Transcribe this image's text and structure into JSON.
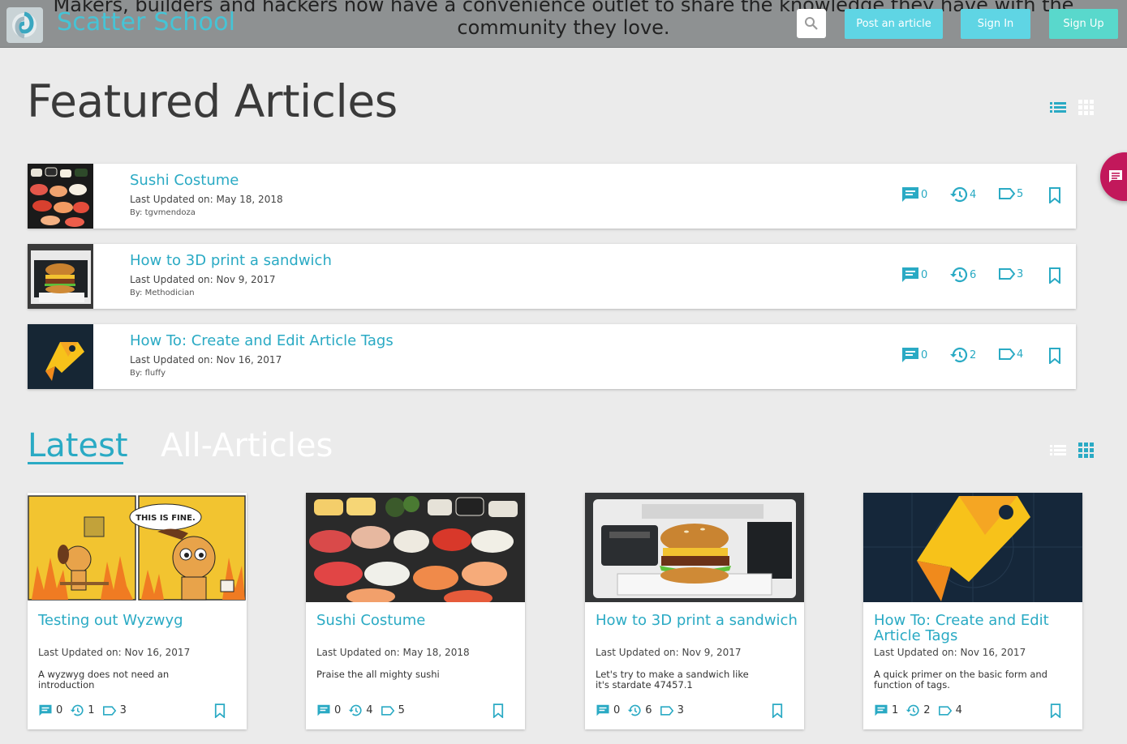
{
  "header": {
    "brand": "Scatter School",
    "tagline": "Makers, builders and hackers now have a convenience outlet to share the knowledge they have with the community they love.",
    "buttons": {
      "post": "Post an article",
      "signin": "Sign In",
      "signup": "Sign Up"
    },
    "colors": {
      "bar": "#8e9192",
      "accent": "#5fd5e4",
      "signup": "#59d8cc"
    }
  },
  "featured": {
    "title": "Featured Articles",
    "items": [
      {
        "title": "Sushi Costume",
        "updated_label": "Last Updated on:",
        "updated": "May 18, 2018",
        "by_label": "By:",
        "author": "tgvmendoza",
        "comments": "0",
        "revisions": "4",
        "tags": "5",
        "thumb": "sushi"
      },
      {
        "title": "How to 3D print a sandwich",
        "updated_label": "Last Updated on:",
        "updated": "Nov 9, 2017",
        "by_label": "By:",
        "author": "Methodician",
        "comments": "0",
        "revisions": "6",
        "tags": "3",
        "thumb": "printer"
      },
      {
        "title": "How To: Create and Edit Article Tags",
        "updated_label": "Last Updated on:",
        "updated": "Nov 16, 2017",
        "by_label": "By:",
        "author": "fluffy",
        "comments": "0",
        "revisions": "2",
        "tags": "4",
        "thumb": "tag"
      }
    ]
  },
  "latest": {
    "tabs": {
      "latest": "Latest",
      "all": "All-Articles"
    },
    "cards": [
      {
        "title": "Testing out Wyzwyg",
        "updated_label": "Last Updated on:",
        "updated": "Nov 16, 2017",
        "description": "A wyzwyg does not need an introduction",
        "comments": "0",
        "revisions": "1",
        "tags": "3",
        "image": "this-is-fine-comic",
        "speech": "THIS IS FINE."
      },
      {
        "title": "Sushi Costume",
        "updated_label": "Last Updated on:",
        "updated": "May 18, 2018",
        "description": "Praise the all mighty sushi",
        "comments": "0",
        "revisions": "4",
        "tags": "5",
        "image": "sushi"
      },
      {
        "title": "How to 3D print a sandwich",
        "updated_label": "Last Updated on:",
        "updated": "Nov 9, 2017",
        "description": "Let's try to make a sandwich like it's stardate 47457.1",
        "comments": "0",
        "revisions": "6",
        "tags": "3",
        "image": "printer"
      },
      {
        "title": "How To: Create and Edit Article Tags",
        "updated_label": "Last Updated on:",
        "updated": "Nov 16, 2017",
        "description": "A quick primer on the basic form and function of tags.",
        "comments": "1",
        "revisions": "2",
        "tags": "4",
        "image": "tag"
      }
    ]
  },
  "icons": {
    "search": "search-icon",
    "list": "list-view-icon",
    "grid": "grid-view-icon",
    "comment": "comment-icon",
    "history": "history-icon",
    "tag": "tag-icon",
    "bookmark": "bookmark-icon",
    "chat": "chat-icon"
  },
  "colors": {
    "accent": "#2aaac4",
    "fab": "#c2185b",
    "background": "#ebebeb"
  }
}
